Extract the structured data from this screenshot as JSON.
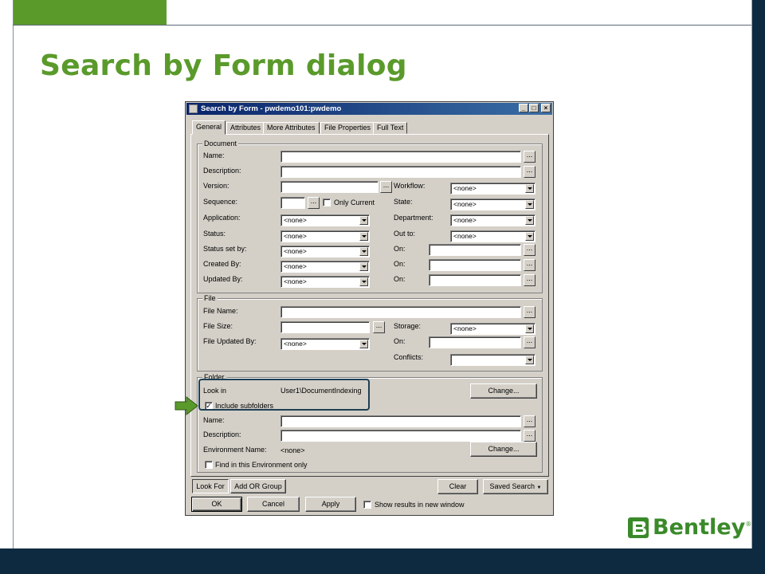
{
  "slide": {
    "title": "Search by Form dialog",
    "logo_text": "Bentley",
    "logo_reg": "®"
  },
  "dialog": {
    "title": "Search by Form - pwdemo101:pwdemo",
    "tabs": [
      "General",
      "Attributes",
      "More Attributes",
      "File Properties",
      "Full Text"
    ],
    "document": {
      "legend": "Document",
      "name_label": "Name:",
      "description_label": "Description:",
      "version_label": "Version:",
      "workflow_label": "Workflow:",
      "workflow_value": "<none>",
      "sequence_label": "Sequence:",
      "only_current_label": "Only Current",
      "state_label": "State:",
      "state_value": "<none>",
      "application_label": "Application:",
      "application_value": "<none>",
      "department_label": "Department:",
      "department_value": "<none>",
      "status_label": "Status:",
      "status_value": "<none>",
      "out_to_label": "Out to:",
      "out_to_value": "<none>",
      "status_set_by_label": "Status set by:",
      "status_set_by_value": "<none>",
      "created_by_label": "Created By:",
      "created_by_value": "<none>",
      "updated_by_label": "Updated By:",
      "updated_by_value": "<none>",
      "on_label": "On:"
    },
    "file": {
      "legend": "File",
      "file_name_label": "File Name:",
      "file_size_label": "File Size:",
      "storage_label": "Storage:",
      "storage_value": "<none>",
      "file_updated_by_label": "File Updated By:",
      "file_updated_by_value": "<none>",
      "on_label": "On:",
      "conflicts_label": "Conflicts:"
    },
    "folder": {
      "legend": "Folder",
      "look_in_label": "Look in",
      "look_in_value": "User1\\DocumentIndexing",
      "change_label": "Change...",
      "include_subfolders_label": "Include subfolders",
      "include_subfolders_checked": true,
      "name_label": "Name:",
      "description_label": "Description:",
      "environment_name_label": "Environment Name:",
      "environment_name_value": "<none>",
      "change2_label": "Change...",
      "find_in_env_label": "Find in this Environment only",
      "find_in_env_checked": false
    },
    "bottom": {
      "look_for_tab": "Look For",
      "add_or_group_tab": "Add OR Group",
      "clear_label": "Clear",
      "saved_search_label": "Saved Search",
      "ok_label": "OK",
      "cancel_label": "Cancel",
      "apply_label": "Apply",
      "show_results_label": "Show results in new window",
      "show_results_checked": false
    }
  },
  "colors": {
    "brand_green": "#5a9a2b",
    "navy": "#0d2a40",
    "dialog_face": "#d4d0c8"
  }
}
